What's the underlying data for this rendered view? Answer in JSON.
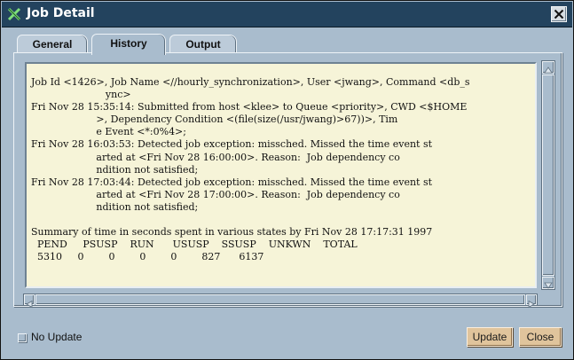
{
  "window": {
    "title": "Job Detail",
    "app_icon": "x-logo-icon",
    "close_icon": "close-icon"
  },
  "tabs": [
    {
      "label": "General",
      "active": false
    },
    {
      "label": "History",
      "active": true
    },
    {
      "label": "Output",
      "active": false
    }
  ],
  "history": {
    "lines": [
      "Job Id <1426>, Job Name <//hourly_synchronization>, User <jwang>, Command <db_s",
      "                        ync>",
      "Fri Nov 28 15:35:14: Submitted from host <klee> to Queue <priority>, CWD <$HOME",
      "                     >, Dependency Condition <(file(size(/usr/jwang)>67))>, Tim",
      "                     e Event <*:0%4>;",
      "Fri Nov 28 16:03:53: Detected job exception: missched. Missed the time event st",
      "                     arted at <Fri Nov 28 16:00:00>. Reason:  Job dependency co",
      "                     ndition not satisfied;",
      "Fri Nov 28 17:03:44: Detected job exception: missched. Missed the time event st",
      "                     arted at <Fri Nov 28 17:00:00>. Reason:  Job dependency co",
      "                     ndition not satisfied;",
      "",
      "Summary of time in seconds spent in various states by Fri Nov 28 17:17:31 1997",
      "  PEND     PSUSP    RUN      USUSP    SSUSP    UNKWN    TOTAL",
      "  5310     0        0        0        0        827      6137"
    ]
  },
  "footer": {
    "no_update_label": "No Update",
    "no_update_checked": false,
    "update_label": "Update",
    "close_label": "Close"
  },
  "colors": {
    "titlebar": "#23435e",
    "window_bg": "#a9bccd",
    "text_bg": "#f6f4d8",
    "button_bg": "#e0c49c"
  }
}
